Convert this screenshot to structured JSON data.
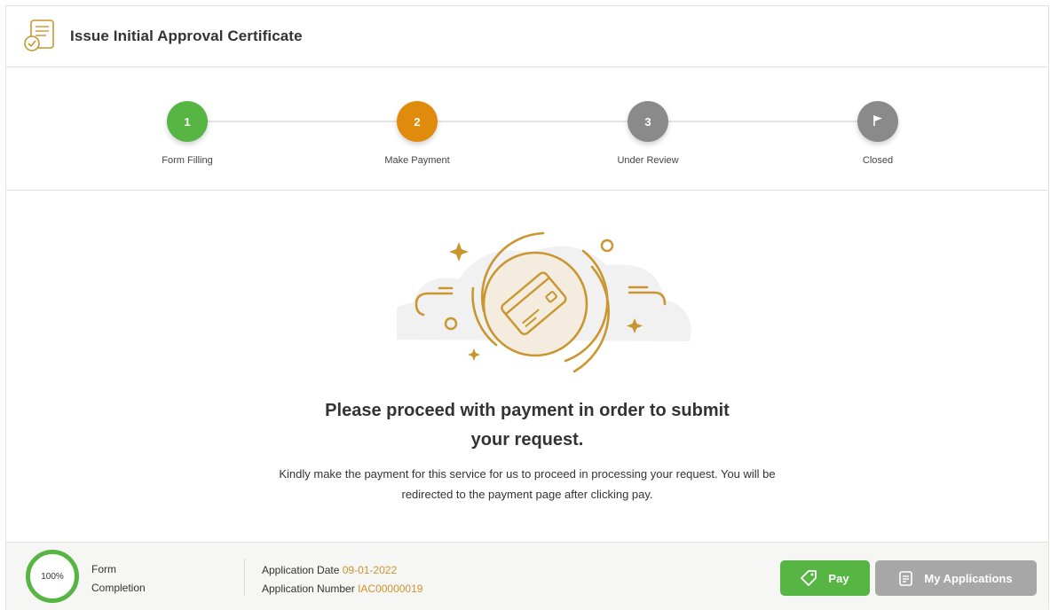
{
  "header": {
    "title": "Issue Initial Approval Certificate",
    "icon": "certificate-icon"
  },
  "stepper": {
    "steps": [
      {
        "number": "1",
        "label": "Form Filling",
        "status": "completed",
        "color": "#57b544"
      },
      {
        "number": "2",
        "label": "Make Payment",
        "status": "current",
        "color": "#e08b0c"
      },
      {
        "number": "3",
        "label": "Under Review",
        "status": "pending",
        "color": "#8a8a8a"
      },
      {
        "number": "",
        "label": "Closed",
        "status": "pending",
        "icon": "flag-icon",
        "color": "#8a8a8a"
      }
    ]
  },
  "main": {
    "illustration_icon": "credit-card-icon",
    "headline_line1": "Please proceed with payment in order to submit",
    "headline_line2": "your request.",
    "subtext_line1": "Kindly make the payment for this service for us to proceed in processing your request. You will be",
    "subtext_line2": "redirected to the payment page after clicking pay."
  },
  "footer": {
    "completion_percent": "100%",
    "completion_label_line1": "Form",
    "completion_label_line2": "Completion",
    "application_date_label": "Application Date",
    "application_date": "09-01-2022",
    "application_number_label": "Application Number",
    "application_number": "IAC00000019",
    "pay_label": "Pay",
    "my_applications_label": "My Applications"
  },
  "colors": {
    "accent_green": "#57b544",
    "accent_orange": "#e08b0c",
    "gold": "#c9962f",
    "gray": "#a7a7a7"
  }
}
